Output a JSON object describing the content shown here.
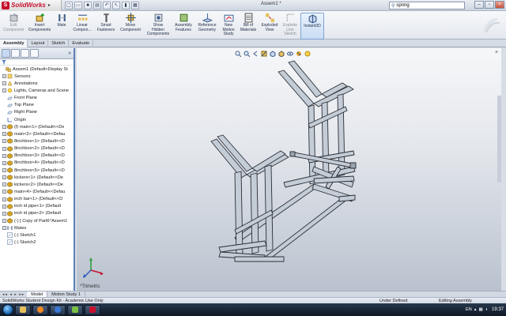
{
  "app": {
    "brand": "SolidWorks",
    "document_title": "Assem1 *",
    "search_value": "spring"
  },
  "ribbon": {
    "buttons": [
      {
        "label": "Edit\nComponent",
        "icon": "edit-component-icon",
        "enabled": false
      },
      {
        "label": "Insert\nComponents",
        "icon": "insert-components-icon",
        "enabled": true
      },
      {
        "label": "Mate",
        "icon": "mate-icon",
        "enabled": true
      },
      {
        "label": "Linear\nCompon...",
        "icon": "linear-pattern-icon",
        "enabled": true
      },
      {
        "label": "Smart\nFasteners",
        "icon": "smart-fasteners-icon",
        "enabled": true
      },
      {
        "label": "Move\nComponent",
        "icon": "move-component-icon",
        "enabled": true
      },
      {
        "label": "Show\nHidden\nComponents",
        "icon": "show-hidden-icon",
        "enabled": true
      },
      {
        "label": "Assembly\nFeatures",
        "icon": "assembly-features-icon",
        "enabled": true
      },
      {
        "label": "Reference\nGeometry",
        "icon": "reference-geometry-icon",
        "enabled": true
      },
      {
        "label": "New\nMotion\nStudy",
        "icon": "new-motion-study-icon",
        "enabled": true
      },
      {
        "label": "Bill of\nMaterials",
        "icon": "bill-of-materials-icon",
        "enabled": true
      },
      {
        "label": "Exploded\nView",
        "icon": "exploded-view-icon",
        "enabled": true
      },
      {
        "label": "Explode\nLine\nSketch",
        "icon": "explode-line-icon",
        "enabled": false
      },
      {
        "label": "Instant3D",
        "icon": "instant3d-icon",
        "enabled": true,
        "active": true
      }
    ]
  },
  "tabs": [
    {
      "label": "Assembly",
      "active": true
    },
    {
      "label": "Layout",
      "active": false
    },
    {
      "label": "Sketch",
      "active": false
    },
    {
      "label": "Evaluate",
      "active": false
    }
  ],
  "tree": [
    {
      "label": "Assem1  (Default<Display St",
      "icon": "assembly-icon",
      "level": 0,
      "exp": ""
    },
    {
      "label": "Sensors",
      "icon": "sensor-icon",
      "level": 1,
      "exp": "+"
    },
    {
      "label": "Annotations",
      "icon": "annotation-icon",
      "level": 1,
      "exp": "+"
    },
    {
      "label": "Lights, Cameras and Scene",
      "icon": "lights-icon",
      "level": 1,
      "exp": "+"
    },
    {
      "label": "Front Plane",
      "icon": "plane-icon",
      "level": 1,
      "exp": ""
    },
    {
      "label": "Top Plane",
      "icon": "plane-icon",
      "level": 1,
      "exp": ""
    },
    {
      "label": "Right Plane",
      "icon": "plane-icon",
      "level": 1,
      "exp": ""
    },
    {
      "label": "Origin",
      "icon": "origin-icon",
      "level": 1,
      "exp": ""
    },
    {
      "label": "(f) main<1> (Default<<De",
      "icon": "part-icon",
      "level": 1,
      "exp": "+"
    },
    {
      "label": "main<2> (Default<<Defau",
      "icon": "part-icon",
      "level": 1,
      "exp": "+"
    },
    {
      "label": "8inchbox<1> (Default<<D",
      "icon": "part-icon",
      "level": 1,
      "exp": "+"
    },
    {
      "label": "8inchbox<2> (Default<<D",
      "icon": "part-icon",
      "level": 1,
      "exp": "+"
    },
    {
      "label": "8inchbox<3> (Default<<D",
      "icon": "part-icon",
      "level": 1,
      "exp": "+"
    },
    {
      "label": "8inchbox<4> (Default<<D",
      "icon": "part-icon",
      "level": 1,
      "exp": "+"
    },
    {
      "label": "8inchbox<5> (Default<<D",
      "icon": "part-icon",
      "level": 1,
      "exp": "+"
    },
    {
      "label": "kickers<1> (Default<<De",
      "icon": "part-icon",
      "level": 1,
      "exp": "+"
    },
    {
      "label": "kickers<2> (Default<<De",
      "icon": "part-icon",
      "level": 1,
      "exp": "+"
    },
    {
      "label": "main<4> (Default<<Defau",
      "icon": "part-icon",
      "level": 1,
      "exp": "+"
    },
    {
      "label": "inch bar<1> (Default<<D",
      "icon": "part-icon",
      "level": 1,
      "exp": "+"
    },
    {
      "label": "inch id pipe<1> (Default",
      "icon": "part-icon",
      "level": 1,
      "exp": "+"
    },
    {
      "label": "inch id pipe<2> (Default",
      "icon": "part-icon",
      "level": 1,
      "exp": "+"
    },
    {
      "label": "(-) [ Copy of Part6^Assem1",
      "icon": "part-icon",
      "level": 1,
      "exp": "+"
    },
    {
      "label": "Mates",
      "icon": "mates-icon",
      "level": 1,
      "exp": "+"
    },
    {
      "label": "(-) Sketch1",
      "icon": "sketch-icon",
      "level": 1,
      "exp": ""
    },
    {
      "label": "(-) Sketch2",
      "icon": "sketch-icon",
      "level": 1,
      "exp": ""
    }
  ],
  "viewport": {
    "view_name": "*Trimetric"
  },
  "bottom_tabs": [
    {
      "label": "Model",
      "active": true
    },
    {
      "label": "Motion Study 1",
      "active": false
    }
  ],
  "status": {
    "left": "SolidWorks Student Design Kit - Academic Use Only",
    "mid": "Under Defined",
    "right": "Editing Assembly"
  },
  "taskbar": {
    "language": "EN",
    "clock": "19:37"
  },
  "colors": {
    "accent": "#5b7fb5",
    "part_icon": "#d8a31e",
    "model_steel": "#c4ccd6"
  }
}
